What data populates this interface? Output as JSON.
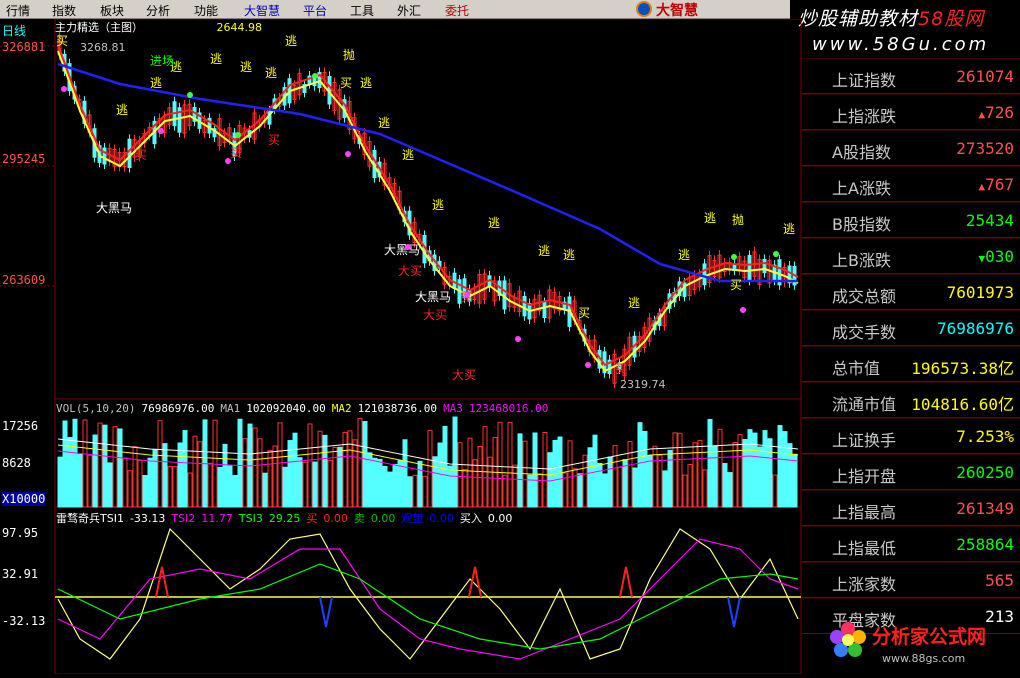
{
  "menu": [
    {
      "label": "行情",
      "color": "black"
    },
    {
      "label": "指数",
      "color": "black"
    },
    {
      "label": "板块",
      "color": "black"
    },
    {
      "label": "分析",
      "color": "black"
    },
    {
      "label": "功能",
      "color": "black"
    },
    {
      "label": "大智慧",
      "color": "blue"
    },
    {
      "label": "平台",
      "color": "blue"
    },
    {
      "label": "工具",
      "color": "black"
    },
    {
      "label": "外汇",
      "color": "black"
    },
    {
      "label": "委托",
      "color": "red"
    }
  ],
  "brand": "大智慧",
  "banner": {
    "line1_a": "炒股辅助教材",
    "line1_b": "58股网",
    "line2": "www.58Gu.com"
  },
  "main_chart": {
    "period": "日线",
    "indicator_line": "主力精选（主图）",
    "ma_text": "2644.98",
    "y_labels": [
      "326881",
      "295245",
      "263609"
    ],
    "high_label": "3268.81",
    "low_label": "2319.74",
    "tags": [
      {
        "t": "逃",
        "c": "#ffff00"
      },
      {
        "t": "抛",
        "c": "#ffff00"
      },
      {
        "t": "买",
        "c": "#ff2020"
      },
      {
        "t": "大黑马",
        "c": "#ffffff"
      },
      {
        "t": "大买",
        "c": "#ff2020"
      },
      {
        "t": "进场",
        "c": "#00ff00"
      }
    ]
  },
  "vol_chart": {
    "info": "VOL(5,10,20)  76986976.00  MA1  102092040.00  MA2  121038736.00  MA3  123468016.00",
    "info_parts": [
      {
        "t": "VOL(5,10,20)",
        "c": "#c0c0c0"
      },
      {
        "t": "76986976.00",
        "c": "#ffffff"
      },
      {
        "t": "MA1",
        "c": "#c0c0c0"
      },
      {
        "t": "102092040.00",
        "c": "#ffffff"
      },
      {
        "t": "MA2",
        "c": "#ffff00"
      },
      {
        "t": "121038736.00",
        "c": "#ffffff"
      },
      {
        "t": "MA3",
        "c": "#ff00ff"
      },
      {
        "t": "123468016.00",
        "c": "#ff00ff"
      }
    ],
    "y_labels": [
      "17256",
      "8628"
    ],
    "unit": "X10000"
  },
  "tsi_chart": {
    "info_parts": [
      {
        "t": "雷骛奇兵TSI1",
        "c": "#ffffff"
      },
      {
        "t": "-33.13",
        "c": "#ffffff"
      },
      {
        "t": "TSI2",
        "c": "#ff00ff"
      },
      {
        "t": "11.77",
        "c": "#ff00ff"
      },
      {
        "t": "TSI3",
        "c": "#00ff00"
      },
      {
        "t": "29.25",
        "c": "#00ff00"
      },
      {
        "t": "买",
        "c": "#ff2020"
      },
      {
        "t": "0.00",
        "c": "#ff2020"
      },
      {
        "t": "卖",
        "c": "#00c000"
      },
      {
        "t": "0.00",
        "c": "#00c000"
      },
      {
        "t": "观望",
        "c": "#0000ff"
      },
      {
        "t": "0.00",
        "c": "#0000ff"
      },
      {
        "t": "买入",
        "c": "#ffffff"
      },
      {
        "t": "0.00",
        "c": "#ffffff"
      }
    ],
    "y_labels": [
      "97.95",
      "32.91",
      "-32.13"
    ]
  },
  "panel": [
    {
      "label": "上证指数",
      "value": "261074",
      "color": "#ff5050",
      "arrow": ""
    },
    {
      "label": "上指涨跌",
      "value": "726",
      "color": "#ff5050",
      "arrow": "up"
    },
    {
      "label": "A股指数",
      "value": "273520",
      "color": "#ff5050",
      "arrow": ""
    },
    {
      "label": "上A涨跌",
      "value": "767",
      "color": "#ff5050",
      "arrow": "up"
    },
    {
      "label": "B股指数",
      "value": "25434",
      "color": "#00ff00",
      "arrow": ""
    },
    {
      "label": "上B涨跌",
      "value": "030",
      "color": "#00ff00",
      "arrow": "down"
    },
    {
      "label": "成交总额",
      "value": "7601973",
      "color": "#ffff00",
      "arrow": ""
    },
    {
      "label": "成交手数",
      "value": "76986976",
      "color": "#00ffff",
      "arrow": ""
    },
    {
      "label": "总市值",
      "value": "196573.38亿",
      "color": "#ffff00",
      "arrow": ""
    },
    {
      "label": "流通市值",
      "value": "104816.60亿",
      "color": "#ffff00",
      "arrow": ""
    },
    {
      "label": "上证换手",
      "value": "7.253%",
      "color": "#ffff00",
      "arrow": ""
    },
    {
      "label": "上指开盘",
      "value": "260250",
      "color": "#00ff00",
      "arrow": ""
    },
    {
      "label": "上指最高",
      "value": "261349",
      "color": "#ff5050",
      "arrow": ""
    },
    {
      "label": "上指最低",
      "value": "258864",
      "color": "#00ff00",
      "arrow": ""
    },
    {
      "label": "上涨家数",
      "value": "565",
      "color": "#ff5050",
      "arrow": ""
    },
    {
      "label": "平盘家数",
      "value": "213",
      "color": "#ffffff",
      "arrow": ""
    }
  ],
  "footer": {
    "name": "分析家公式网",
    "url": "www.88gs.com"
  },
  "colors": {
    "up": "#ff3030",
    "down": "#54ffff",
    "ma_slow": "#2020ff",
    "ma_fast": "#ffff40",
    "ma_mid": "#ff2020",
    "grid": "#800000"
  }
}
